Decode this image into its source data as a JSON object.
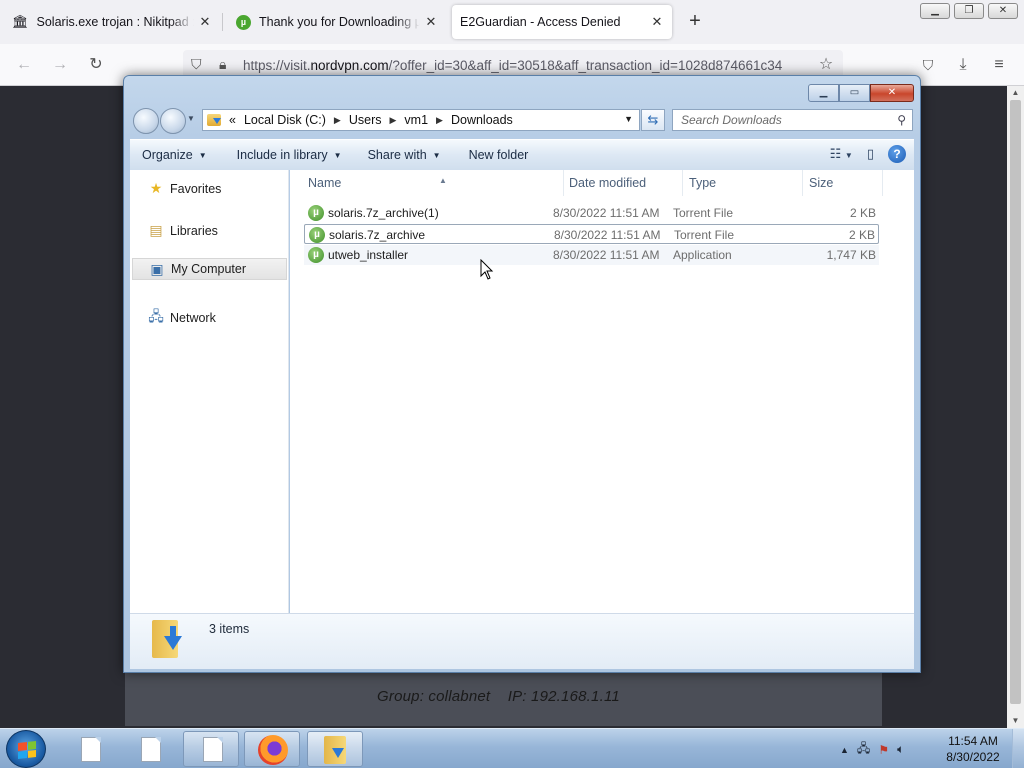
{
  "browser": {
    "tabs": [
      {
        "title": "Solaris.exe trojan : Nikitpad : Free",
        "icon": "archive-building-icon",
        "active": false
      },
      {
        "title": "Thank you for Downloading µTorrent",
        "icon": "utorrent-icon",
        "active": false
      },
      {
        "title": "E2Guardian - Access Denied",
        "icon": "none",
        "active": true
      }
    ],
    "url_prefix": "https://visit.",
    "url_domain": "nordvpn.com",
    "url_rest": "/?offer_id=30&aff_id=30518&aff_transaction_id=1028d874661c34"
  },
  "page": {
    "group_info": "Group: collabnet    IP: 192.168.1.11"
  },
  "explorer": {
    "breadcrumb": [
      "Local Disk (C:)",
      "Users",
      "vm1",
      "Downloads"
    ],
    "search_placeholder": "Search Downloads",
    "commands": [
      "Organize",
      "Include in library",
      "Share with",
      "New folder"
    ],
    "nav_items": [
      {
        "label": "Favorites",
        "icon": "star-icon"
      },
      {
        "label": "Libraries",
        "icon": "libraries-icon"
      },
      {
        "label": "My Computer",
        "icon": "computer-icon",
        "selected": true
      },
      {
        "label": "Network",
        "icon": "network-icon"
      }
    ],
    "columns": [
      "Name",
      "Date modified",
      "Type",
      "Size"
    ],
    "files": [
      {
        "name": "solaris.7z_archive(1)",
        "date": "8/30/2022 11:51 AM",
        "type": "Torrent File",
        "size": "2 KB"
      },
      {
        "name": "solaris.7z_archive",
        "date": "8/30/2022 11:51 AM",
        "type": "Torrent File",
        "size": "2 KB"
      },
      {
        "name": "utweb_installer",
        "date": "8/30/2022 11:51 AM",
        "type": "Application",
        "size": "1,747 KB"
      }
    ],
    "status": "3 items"
  },
  "taskbar": {
    "time": "11:54 AM",
    "date": "8/30/2022",
    "colors": {
      "accent": "#1a5ba3"
    }
  }
}
